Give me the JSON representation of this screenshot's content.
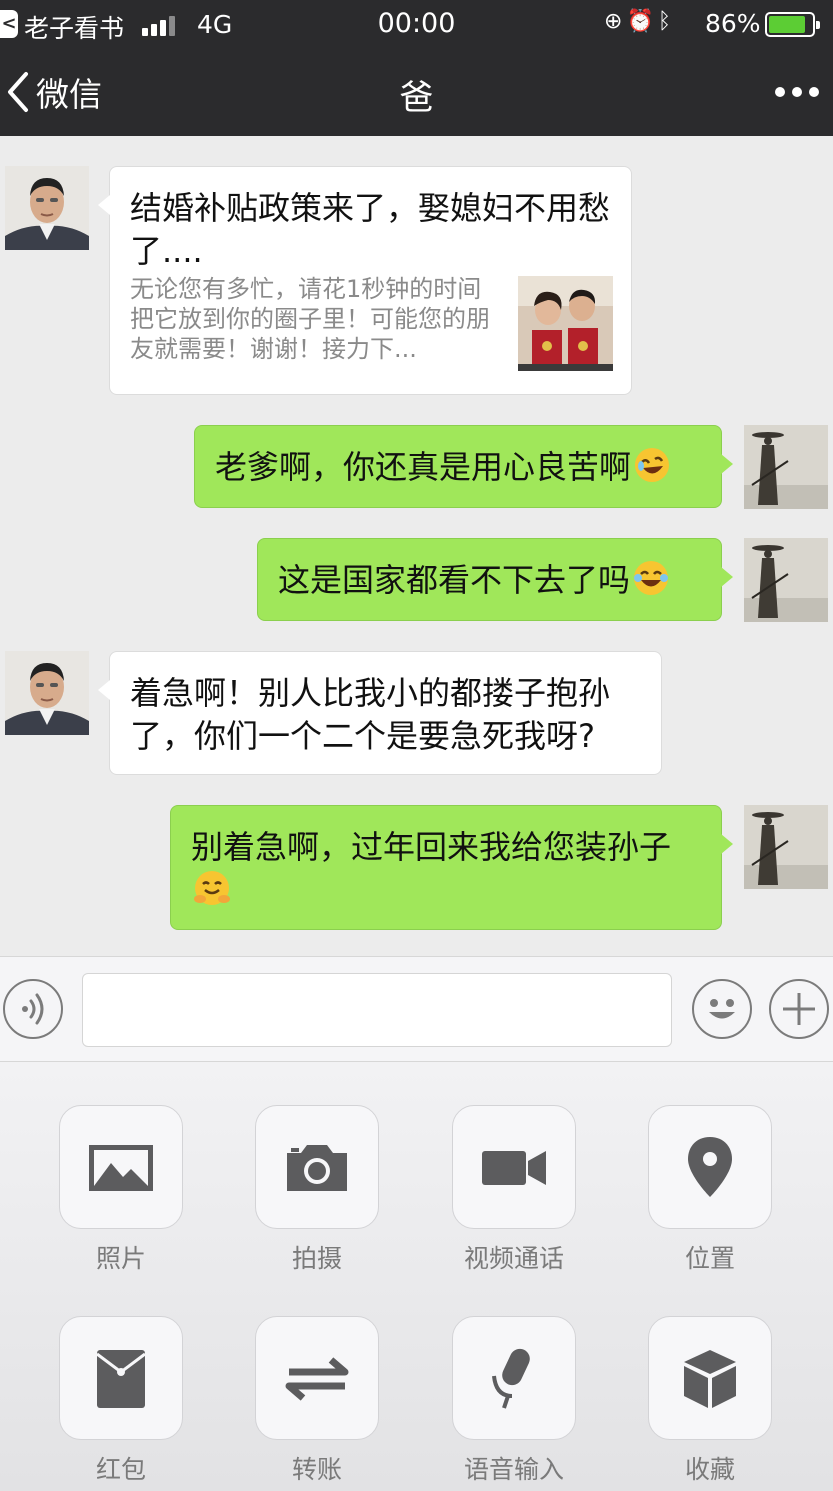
{
  "status_bar": {
    "back_app_glyph": "<",
    "carrier": "老子看书",
    "network": "4G",
    "time": "00:00",
    "battery": "86%",
    "battery_level": 0.86
  },
  "nav": {
    "back_label": "微信",
    "title": "爸"
  },
  "messages": [
    {
      "side": "left",
      "type": "link",
      "title": "结婚补贴政策来了，娶媳妇不用愁了....",
      "description": "无论您有多忙，请花1秒钟的时间把它放到你的圈子里！可能您的朋友就需要！谢谢！接力下..."
    },
    {
      "side": "right",
      "type": "text",
      "text": "老爹啊，你还真是用心良苦啊",
      "emoji": "rolling-laughing-emoji"
    },
    {
      "side": "right",
      "type": "text",
      "text": "这是国家都看不下去了吗",
      "emoji": "tears-of-joy-emoji"
    },
    {
      "side": "left",
      "type": "text",
      "text": "着急啊！别人比我小的都搂子抱孙了，你们一个二个是要急死我呀?"
    },
    {
      "side": "right",
      "type": "text",
      "text": "别着急啊，过年回来我给您装孙子",
      "emoji": "hugging-emoji"
    }
  ],
  "input": {
    "value": "",
    "placeholder": ""
  },
  "panel": [
    {
      "label": "照片",
      "icon": "photo-icon"
    },
    {
      "label": "拍摄",
      "icon": "camera-icon"
    },
    {
      "label": "视频通话",
      "icon": "video-call-icon"
    },
    {
      "label": "位置",
      "icon": "location-icon"
    },
    {
      "label": "红包",
      "icon": "red-packet-icon"
    },
    {
      "label": "转账",
      "icon": "transfer-icon"
    },
    {
      "label": "语音输入",
      "icon": "microphone-icon"
    },
    {
      "label": "收藏",
      "icon": "favorites-icon"
    }
  ],
  "colors": {
    "header_bg": "#2b2b2d",
    "chat_bg": "#ececec",
    "bubble_self": "#a0e75a",
    "bubble_other": "#ffffff",
    "battery_fill": "#5ccd34"
  }
}
